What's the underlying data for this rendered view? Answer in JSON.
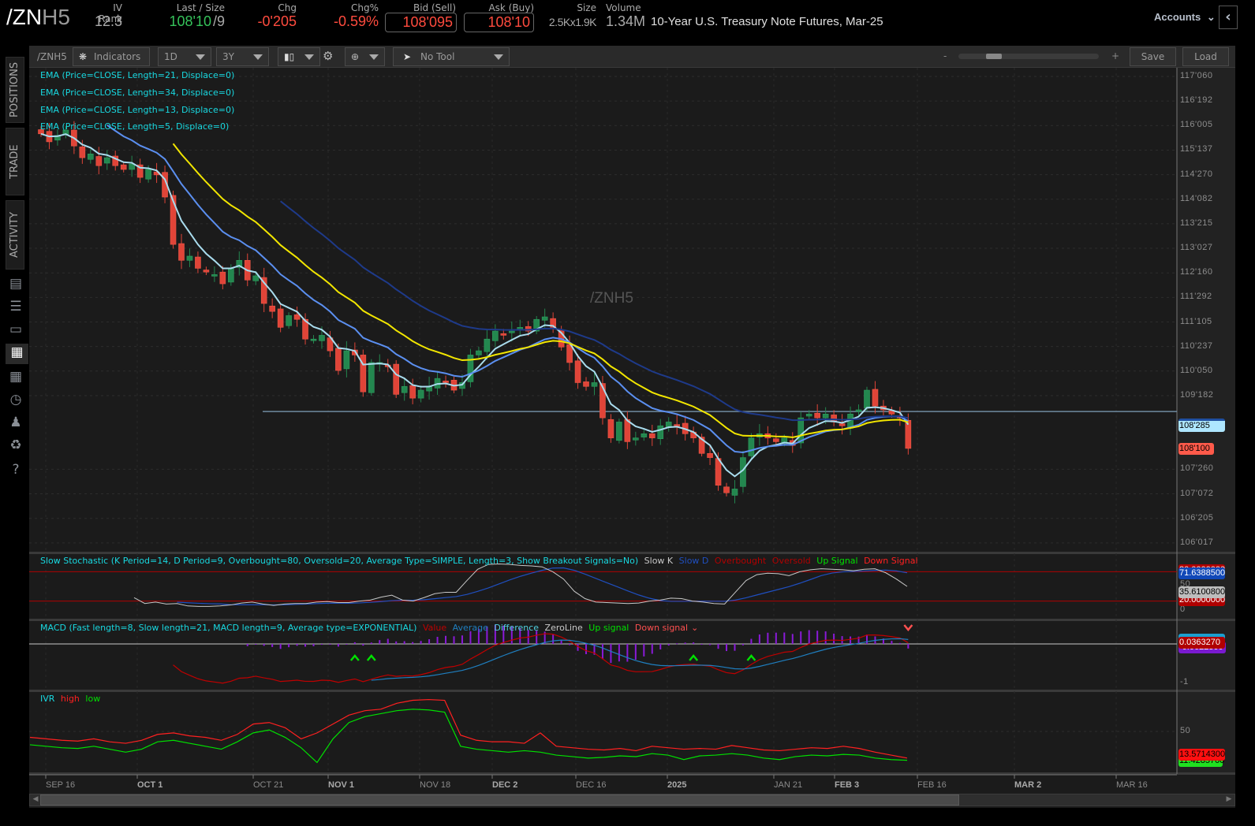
{
  "header": {
    "symbol_root": "/ZN",
    "symbol_suffix": "H5",
    "iv_rank_label": "IV Rank",
    "iv_rank": "12.3",
    "last_size_label": "Last / Size",
    "last": "108'10",
    "size_last": "/9",
    "chg_label": "Chg",
    "chg": "-0'205",
    "chgpct_label": "Chg%",
    "chgpct": "-0.59%",
    "bid_label": "Bid (Sell)",
    "bid": "108'095",
    "ask_label": "Ask (Buy)",
    "ask": "108'10",
    "size_label": "Size",
    "size": "2.5Kx1.9K",
    "volume_label": "Volume",
    "volume": "1.34M",
    "description": "10-Year U.S. Treasury Note Futures, Mar-25",
    "accounts": "Accounts"
  },
  "sidebar": {
    "tabs": [
      "POSITIONS",
      "TRADE",
      "ACTIVITY"
    ],
    "icons": [
      "reports-icon",
      "list-icon",
      "tv-icon",
      "chart-icon",
      "grid-icon",
      "clock-icon",
      "community-icon",
      "calendar-icon",
      "help-icon"
    ]
  },
  "toolbar": {
    "symbol": "/ZNH5",
    "indicators": "Indicators",
    "aggregation": "1D",
    "timeframe": "3Y",
    "drawing_tool": "No Tool",
    "zoom_out": "-",
    "zoom_in": "+",
    "zoom_level": 0.22,
    "save": "Save",
    "load": "Load"
  },
  "studies": {
    "ema": [
      "EMA (Price=CLOSE, Length=21, Displace=0)",
      "EMA (Price=CLOSE, Length=34, Displace=0)",
      "EMA (Price=CLOSE, Length=13, Displace=0)",
      "EMA (Price=CLOSE, Length=5, Displace=0)"
    ],
    "watermark": "/ZNH5",
    "stoch": {
      "title": "Slow Stochastic (K Period=14, D Period=9, Overbought=80, Oversold=20, Average Type=SIMPLE, Length=3, Show Breakout Signals=No)",
      "legend": [
        {
          "label": "Slow K",
          "color": "#c8c8c8"
        },
        {
          "label": "Slow D",
          "color": "#1f4fc0"
        },
        {
          "label": "Overbought",
          "color": "#b00000"
        },
        {
          "label": "Oversold",
          "color": "#b00000"
        },
        {
          "label": "Up Signal",
          "color": "#00e000"
        },
        {
          "label": "Down Signal",
          "color": "#ff2020"
        }
      ],
      "axis": [
        "50",
        "0"
      ],
      "badges": {
        "overbought": "80.0000000",
        "slow_d": "71.6388500",
        "slow_k": "35.6100800",
        "oversold": "20.0000000"
      }
    },
    "macd": {
      "title": "MACD (Fast length=8, Slow length=21, MACD length=9, Average type=EXPONENTIAL)",
      "legend": [
        {
          "label": "Value",
          "color": "#c00000"
        },
        {
          "label": "Average",
          "color": "#1f7fc0"
        },
        {
          "label": "Difference",
          "color": "#50d0e0"
        },
        {
          "label": "ZeroLine",
          "color": "#c8c8c8"
        },
        {
          "label": "Up signal",
          "color": "#00e000"
        },
        {
          "label": "Down signal",
          "color": "#ff5050"
        }
      ],
      "axis": [
        "-1"
      ],
      "badges": {
        "value": "0.0363270",
        "diff": "-0.0622300"
      }
    },
    "ivr": {
      "title": "IVR",
      "legend": [
        {
          "label": "high",
          "color": "#ff2020"
        },
        {
          "label": "low",
          "color": "#00e000"
        }
      ],
      "axis": [
        "50",
        "0"
      ],
      "badges": {
        "high": "13.5714300",
        "low": "11.4285700"
      }
    }
  },
  "price_axis": {
    "ticks": [
      "117'060",
      "116'192",
      "116'005",
      "115'137",
      "114'270",
      "114'082",
      "113'215",
      "113'027",
      "112'160",
      "111'292",
      "111'105",
      "110'237",
      "110'050",
      "109'182",
      "107'260",
      "107'072",
      "106'205",
      "106'017"
    ],
    "last_badge": "108'100",
    "ema_badge": "108'285"
  },
  "date_axis": [
    {
      "label": "SEP 16",
      "major": false
    },
    {
      "label": "OCT 1",
      "major": true
    },
    {
      "label": "OCT 21",
      "major": false
    },
    {
      "label": "NOV 1",
      "major": true
    },
    {
      "label": "NOV 18",
      "major": false
    },
    {
      "label": "DEC 2",
      "major": true
    },
    {
      "label": "DEC 16",
      "major": false
    },
    {
      "label": "2025",
      "major": true
    },
    {
      "label": "JAN 21",
      "major": false
    },
    {
      "label": "FEB 3",
      "major": true
    },
    {
      "label": "FEB 16",
      "major": false
    },
    {
      "label": "MAR 2",
      "major": true
    },
    {
      "label": "MAR 16",
      "major": false
    }
  ],
  "colors": {
    "up": "#23874f",
    "down": "#e04438",
    "ema5": "#a9dcee",
    "ema13": "#5b8ff0",
    "ema21": "#f2e600",
    "ema34": "#1e3a8a"
  },
  "chart_data": {
    "type": "candlestick",
    "title": "/ZNH5 1D",
    "price_range": [
      106.05,
      117.19
    ],
    "horizontal_line": 109.19,
    "closes": [
      115.82,
      115.63,
      115.78,
      115.91,
      115.53,
      115.25,
      115.34,
      115.06,
      115.25,
      115.06,
      114.97,
      115.1,
      114.78,
      114.97,
      114.84,
      114.31,
      113.18,
      112.8,
      112.9,
      112.61,
      112.52,
      112.46,
      112.24,
      112.61,
      112.8,
      112.33,
      112.43,
      111.77,
      111.58,
      111.2,
      111.48,
      111.39,
      110.92,
      110.92,
      111.01,
      110.64,
      110.17,
      110.64,
      110.54,
      109.66,
      110.36,
      110.36,
      110.26,
      109.6,
      109.79,
      109.51,
      109.7,
      109.79,
      109.98,
      109.88,
      109.7,
      109.88,
      110.54,
      110.64,
      110.92,
      111.11,
      111.01,
      111.11,
      111.2,
      111.11,
      111.39,
      111.45,
      111.2,
      110.73,
      110.36,
      109.88,
      109.79,
      109.88,
      109.04,
      108.56,
      108.94,
      108.47,
      108.56,
      108.66,
      108.56,
      108.85,
      108.94,
      108.85,
      108.66,
      108.56,
      108.19,
      108.09,
      107.43,
      107.25,
      107.34,
      108.09,
      108.56,
      108.66,
      108.56,
      108.47,
      108.56,
      108.38,
      109.04,
      109.13,
      109.04,
      109.13,
      108.94,
      108.85,
      109.13,
      109.23,
      109.7,
      109.32,
      109.23,
      109.13,
      109.04,
      108.31
    ],
    "stoch_k": [
      27,
      15,
      18,
      14,
      15,
      10,
      9,
      9,
      10,
      12,
      16,
      18,
      14,
      11,
      14,
      15,
      15,
      18,
      19,
      17,
      17,
      20,
      22,
      28,
      32,
      22,
      20,
      27,
      35,
      38,
      38,
      62,
      85,
      95,
      96,
      95,
      93,
      92,
      90,
      80,
      65,
      40,
      25,
      18,
      17,
      16,
      15,
      16,
      20,
      22,
      26,
      25,
      20,
      18,
      15,
      14,
      38,
      62,
      74,
      77,
      76,
      72,
      80,
      84,
      86,
      85,
      84,
      82,
      85,
      86,
      78,
      65,
      50
    ],
    "macd_up_signals": [
      38,
      40,
      79,
      86
    ],
    "macd_down_signals": [
      105
    ],
    "ivr_high": [
      42,
      40,
      38,
      37,
      40,
      36,
      34,
      38,
      46,
      48,
      44,
      42,
      38,
      46,
      60,
      62,
      55,
      40,
      48,
      60,
      72,
      78,
      80,
      88,
      92,
      93,
      92,
      45,
      38,
      36,
      36,
      34,
      48,
      30,
      28,
      26,
      25,
      27,
      24,
      30,
      28,
      26,
      27,
      26,
      31,
      28,
      25,
      24,
      26,
      28,
      27,
      30,
      27,
      22,
      18,
      14
    ],
    "ivr_low": [
      32,
      30,
      28,
      27,
      30,
      26,
      22,
      26,
      36,
      38,
      34,
      30,
      26,
      36,
      48,
      52,
      42,
      28,
      8,
      40,
      62,
      70,
      74,
      78,
      80,
      79,
      76,
      30,
      26,
      24,
      22,
      24,
      22,
      18,
      16,
      14,
      15,
      17,
      16,
      20,
      18,
      12,
      17,
      18,
      20,
      18,
      14,
      12,
      16,
      18,
      17,
      19,
      18,
      14,
      12,
      11
    ]
  }
}
